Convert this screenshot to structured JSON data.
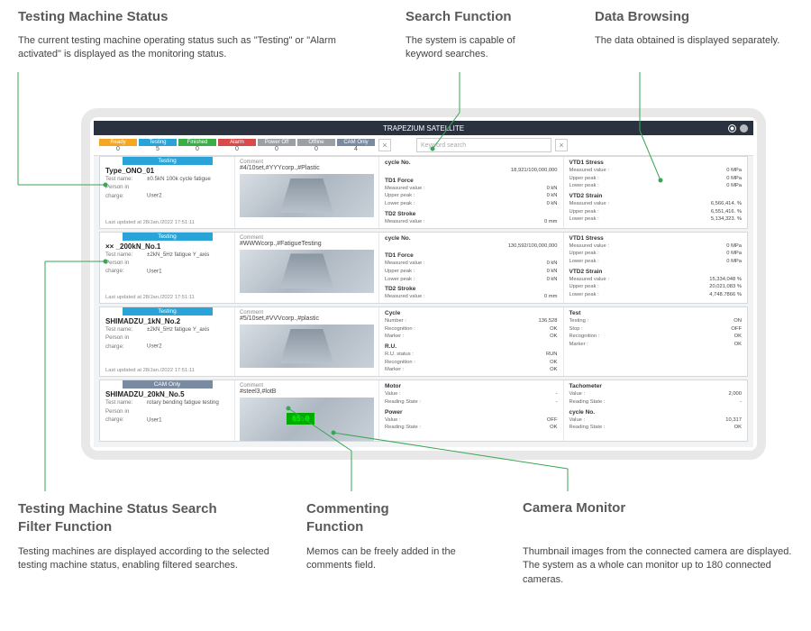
{
  "callouts": {
    "top1_title": "Testing Machine Status",
    "top1_body": "The current testing machine operating status such as \"Testing\" or \"Alarm activated\" is displayed as the monitoring status.",
    "top2_title": "Search Function",
    "top2_body": "The system is capable of keyword searches.",
    "top3_title": "Data Browsing",
    "top3_body": "The data obtained is displayed separately.",
    "bot1_title": "Testing Machine Status Search Filter Function",
    "bot1_body": "Testing machines are displayed according to the selected testing machine status, enabling filtered searches.",
    "bot2_title": "Commenting Function",
    "bot2_body": "Memos can be freely added in the comments field.",
    "bot3_title": "Camera Monitor",
    "bot3_body": "Thumbnail images from the connected camera are displayed. The system as a whole can monitor up to 180 connected cameras."
  },
  "app": {
    "title": "TRAPEZIUM SATELLITE"
  },
  "filters": [
    {
      "label": "Ready",
      "count": "0",
      "color": "#f5a623"
    },
    {
      "label": "Testing",
      "count": "5",
      "color": "#2aa4d8"
    },
    {
      "label": "Finished",
      "count": "0",
      "color": "#3aae49"
    },
    {
      "label": "Alarm",
      "count": "0",
      "color": "#d94b4b"
    },
    {
      "label": "Power Off",
      "count": "0",
      "color": "#9aa0a6"
    },
    {
      "label": "Offline",
      "count": "0",
      "color": "#9aa0a6"
    },
    {
      "label": "CAM Only",
      "count": "4",
      "color": "#7a8aa0"
    }
  ],
  "search_placeholder": "Keyword search",
  "labels": {
    "comment": "Comment",
    "testname": "Test name:",
    "person": "Person in charge:",
    "updated_prefix": "Last updated at",
    "cycleno": "cycle No.",
    "td1force": "TD1 Force",
    "td2stroke": "TD2 Stroke",
    "vtd1stress": "VTD1 Stress",
    "vtd2strain": "VTD2 Strain",
    "measured": "Measured value :",
    "upper": "Upper peak :",
    "lower": "Lower peak :",
    "cycle": "Cycle",
    "number": "Number :",
    "recognition": "Recognition :",
    "marker": "Marker :",
    "ru": "R.U.",
    "rustatus": "R.U. status :",
    "test": "Test",
    "testing_lbl": "Testing :",
    "stop": "Stop :",
    "motor": "Motor",
    "value": "Value :",
    "reading": "Reading State :",
    "power": "Power",
    "tach": "Tachometer"
  },
  "rows": [
    {
      "status": "Testing",
      "status_class": "st-testing",
      "name": "Type_ONO_01",
      "testname": "±0.5kN 100k cycle fatigue",
      "person": "User2",
      "updated": "28/Jan./2022 17:51:11",
      "comment": "#4/10set,#YYYcorp.,#Plastic",
      "thumb": "equip",
      "mid": {
        "cycleno": "18,921/100,000,000",
        "force": {
          "m": "0 kN",
          "u": "0 kN",
          "l": "0 kN"
        },
        "stroke": {
          "m": "0 mm"
        }
      },
      "right": {
        "stress": {
          "m": "0 MPa",
          "u": "0 MPa",
          "l": "0 MPa"
        },
        "strain": {
          "m": "6,566,414. %",
          "u": "6,551,416. %",
          "l": "5,134,323. %"
        }
      }
    },
    {
      "status": "Testing",
      "status_class": "st-testing",
      "name": "×× _200kN_No.1",
      "testname": "±2kN_5Hz fatigue Y_axis",
      "person": "User1",
      "updated": "28/Jan./2022 17:51:11",
      "comment": "#WWWcorp.,#FatigueTesting",
      "thumb": "equip",
      "mid": {
        "cycleno": "130,592/100,000,000",
        "force": {
          "m": "0 kN",
          "u": "0 kN",
          "l": "0 kN"
        },
        "stroke": {
          "m": "0 mm"
        }
      },
      "right": {
        "stress": {
          "m": "0 MPa",
          "u": "0 MPa",
          "l": "0 MPa"
        },
        "strain": {
          "m": "15,334,048 %",
          "u": "20,021,083 %",
          "l": "4,748.7866 %"
        }
      }
    },
    {
      "status": "Testing",
      "status_class": "st-testing",
      "name": "SHIMADZU_1kN_No.2",
      "testname": "±2kN_5Hz fatigue Y_axis",
      "person": "User2",
      "updated": "28/Jan./2022 17:51:11",
      "comment": "#5/10set,#VVVcorp.,#plastic",
      "thumb": "equip",
      "mid2": {
        "cycle": {
          "num": "136,528",
          "rec": "OK",
          "mark": "OK"
        },
        "ru": {
          "status": "RUN",
          "rec": "OK",
          "mark": "OK"
        }
      },
      "right2": {
        "test": {
          "testing": "ON",
          "stop": "OFF",
          "rec": "OK",
          "mark": "OK"
        }
      }
    },
    {
      "status": "CAM Only",
      "status_class": "st-cam",
      "name": "SHIMADZU_20kN_No.5",
      "testname": "rotary bending fatigue testing",
      "person": "User1",
      "updated": "",
      "comment": "#steel3,#lotB",
      "thumb": "panel",
      "mid3": {
        "motor": {
          "val": "-",
          "read": "-"
        },
        "power": {
          "val": "OFF",
          "read": "OK"
        }
      },
      "right3": {
        "tach": {
          "val": "2,000",
          "read": "-"
        },
        "cycle": {
          "val": "10,317",
          "read": "OK"
        }
      }
    }
  ]
}
